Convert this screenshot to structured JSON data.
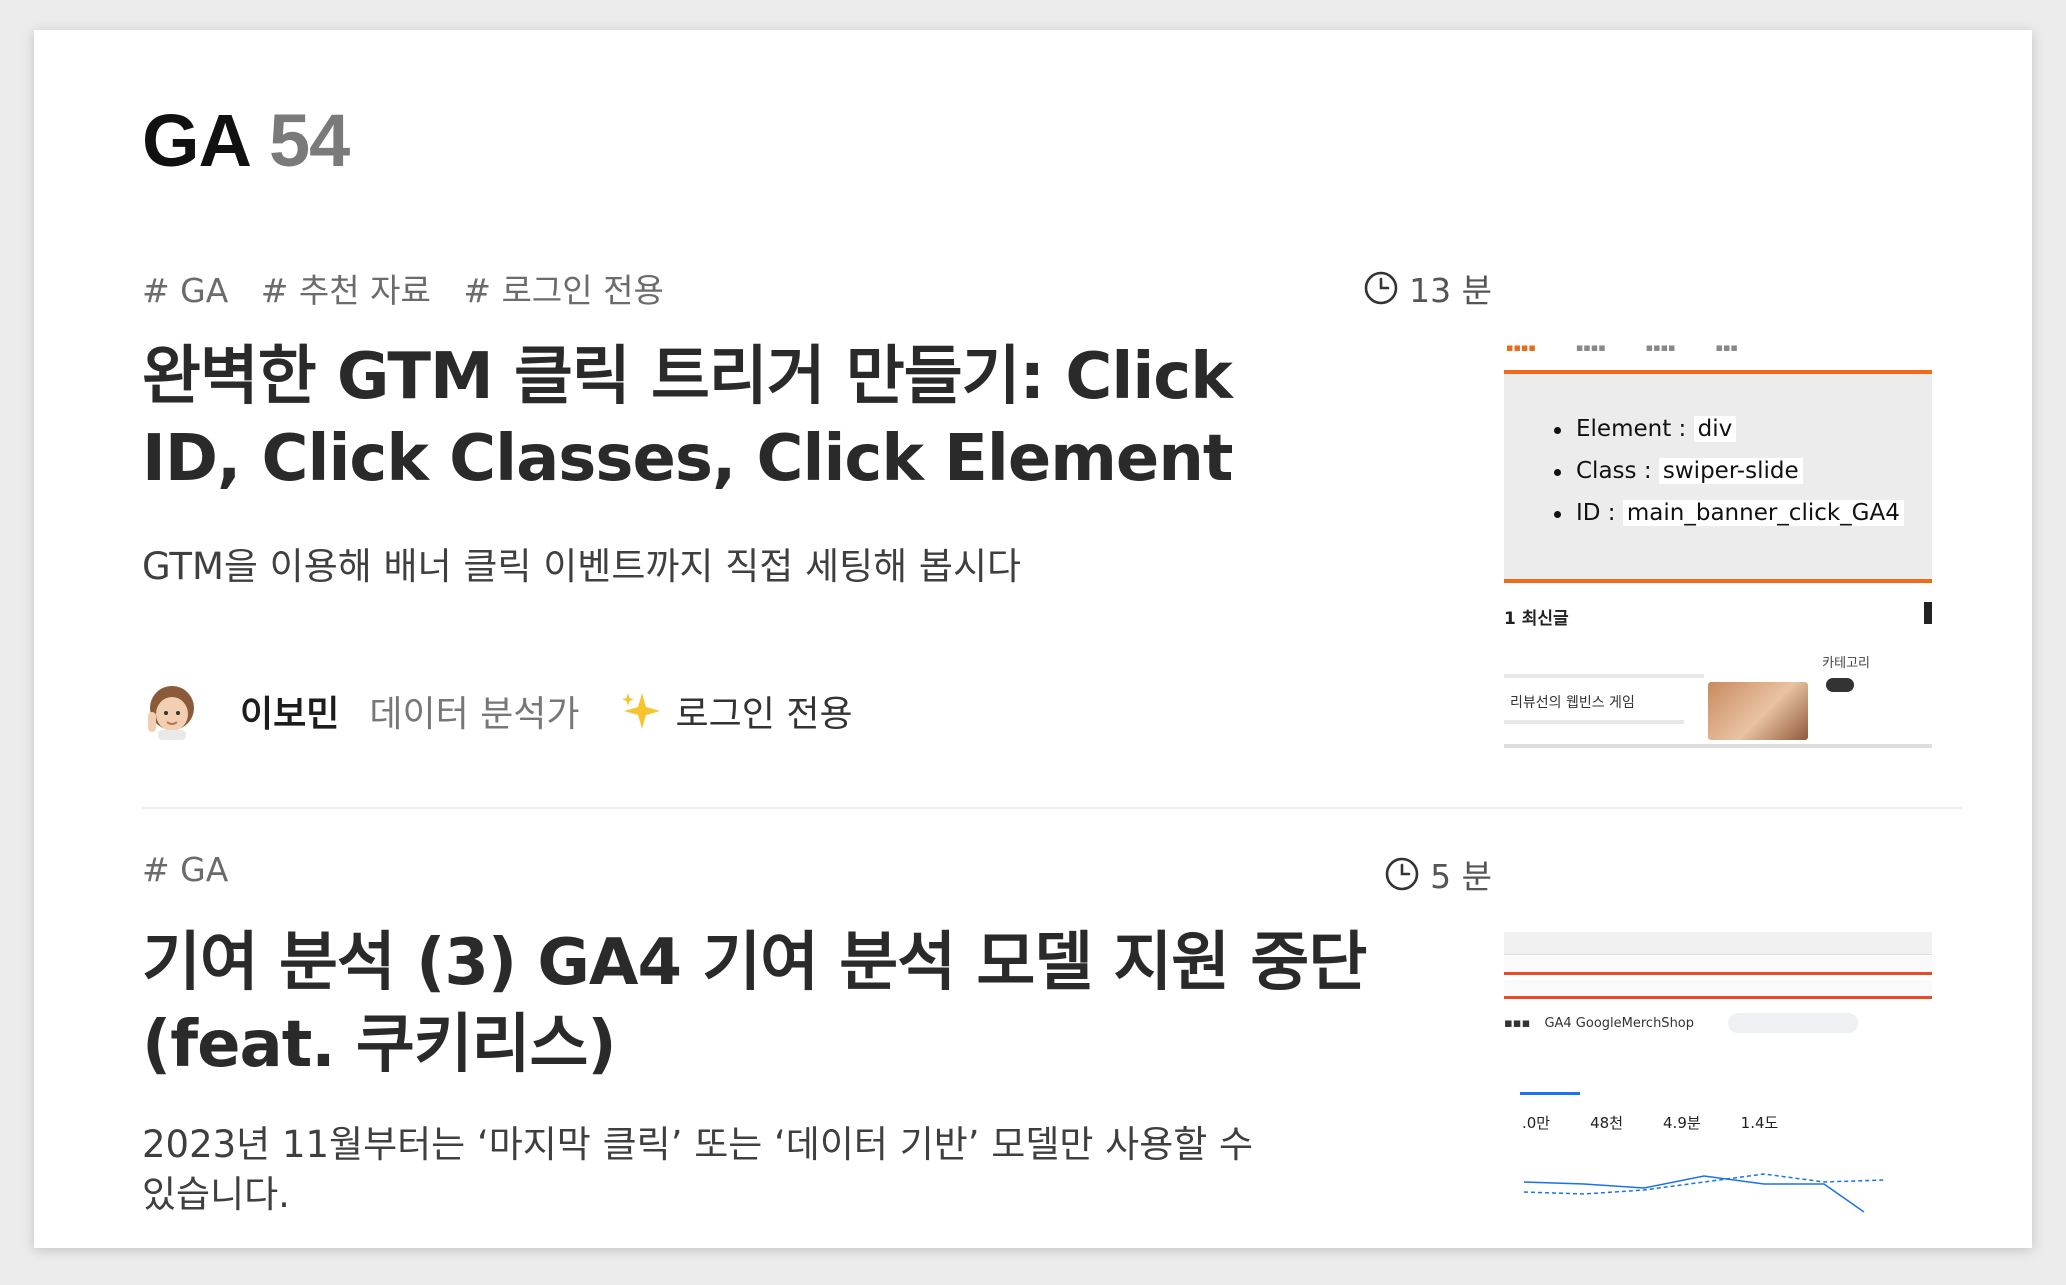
{
  "page": {
    "title": "GA",
    "count": "54"
  },
  "articles": [
    {
      "tags": [
        "# GA",
        "# 추천 자료",
        "# 로그인 전용"
      ],
      "read_time": "13 분",
      "title": "완벽한 GTM 클릭 트리거 만들기: Click ID, Click Classes, Click Element",
      "description": "GTM을 이용해 배너 클릭 이벤트까지 직접 세팅해 봅시다",
      "author": "이보민",
      "role": "데이터 분석가",
      "badge": "로그인 전용",
      "thumbnail": {
        "bullets": [
          {
            "key": "Element :",
            "value": "div"
          },
          {
            "key": "Class :",
            "value": "swiper-slide"
          },
          {
            "key": "ID :",
            "value": "main_banner_click_GA4"
          }
        ],
        "section_heading": "1 최신글",
        "category_label": "카테고리",
        "item_title": "리뷰선의 웹빈스 게임"
      }
    },
    {
      "tags": [
        "# GA"
      ],
      "read_time": "5 분",
      "title": "기여 분석 (3) GA4 기여 분석 모델 지원 중단 (feat. 쿠키리스)",
      "description": "2023년 11월부터는 ‘마지막 클릭’ 또는 ‘데이터 기반’ 모델만 사용할 수 있습니다.",
      "thumbnail": {
        "app_label": "GA4 GoogleMerchShop",
        "metrics": [
          {
            "value": ".0만"
          },
          {
            "value": "48천"
          },
          {
            "value": "4.9분"
          },
          {
            "value": "1.4도"
          }
        ]
      }
    }
  ],
  "colors": {
    "accent_orange": "#f06a1a",
    "ga_blue": "#1a73e8"
  }
}
